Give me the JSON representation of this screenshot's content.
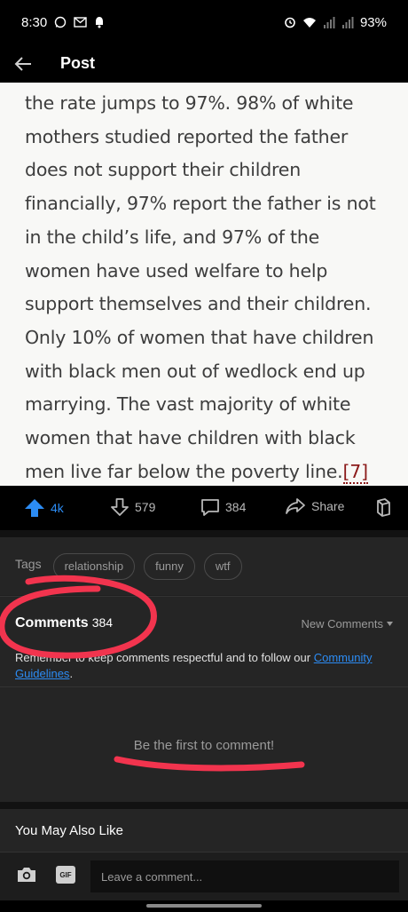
{
  "status_bar": {
    "time": "8:30",
    "battery": "93%",
    "icons": [
      "whatsapp-icon",
      "mail-icon",
      "notification-icon",
      "alarm-icon",
      "wifi-icon",
      "signal-icon",
      "signal-icon",
      "battery-icon"
    ]
  },
  "header": {
    "title": "Post",
    "back_icon": "arrow-left-icon"
  },
  "post": {
    "text": "the rate jumps to 97%. 98% of white mothers studied reported the father does not support their children financially, 97% report the father is not in the child’s life, and 97% of the women have used welfare to help support themselves and their children. Only 10% of women that have children with black men out of wedlock end up marrying. The vast majority of white women that have children with black men live far below the poverty line.",
    "reference": "[7]"
  },
  "actions": {
    "upvotes": "4k",
    "downvotes": "579",
    "comments": "384",
    "share": "Share",
    "upvote_color": "#2c8cf4"
  },
  "tags": {
    "label": "Tags",
    "items": [
      "relationship",
      "funny",
      "wtf"
    ]
  },
  "comments": {
    "heading": "Comments",
    "count": "384",
    "sort": "New Comments",
    "notice_prefix": "Remember to keep comments respectful and to follow our ",
    "notice_link": "Community Guidelines",
    "notice_suffix": ".",
    "empty": "Be the first to comment!"
  },
  "also_like": {
    "heading": "You May Also Like"
  },
  "composer": {
    "gif_label": "GIF",
    "placeholder": "Leave a comment..."
  },
  "colors": {
    "accent": "#2c8cf4",
    "annotation": "#f2344e"
  }
}
